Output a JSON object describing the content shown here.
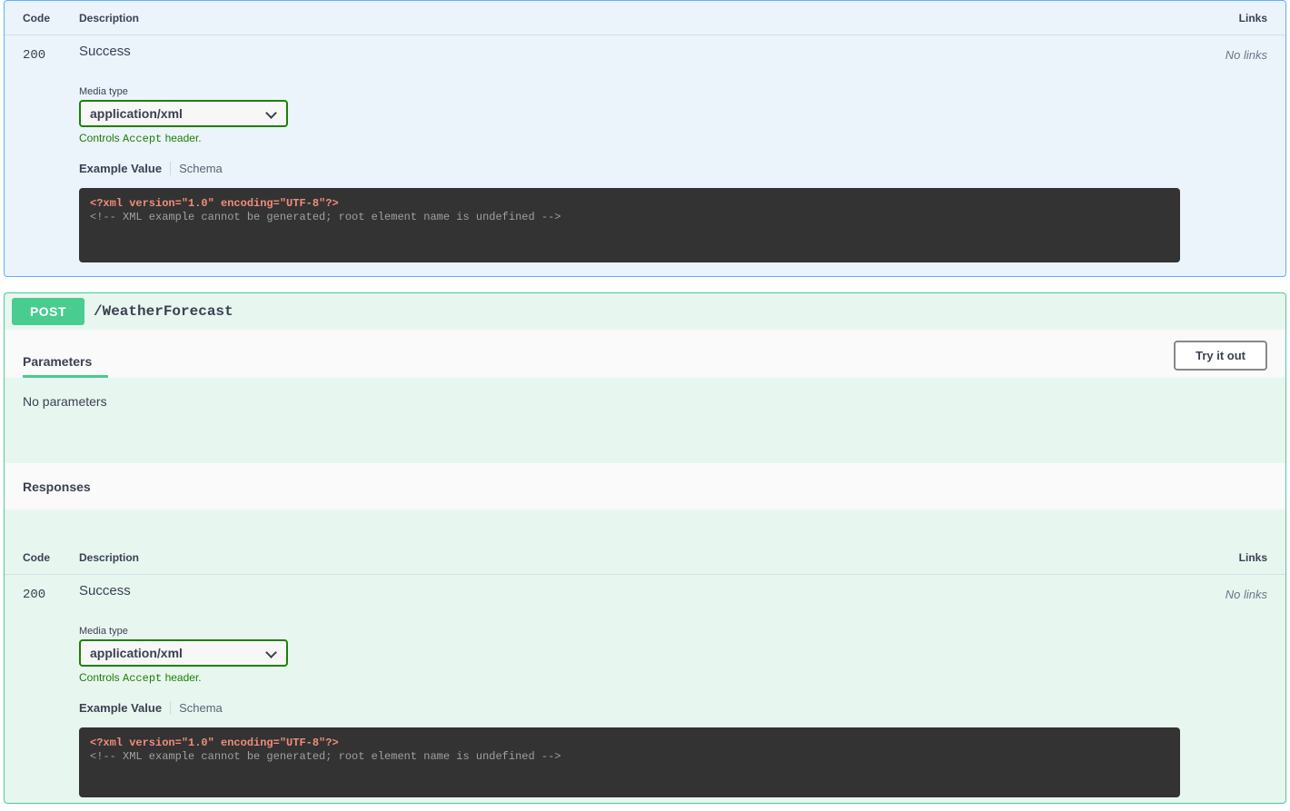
{
  "get_block": {
    "responses_table": {
      "headers": {
        "code": "Code",
        "description": "Description",
        "links": "Links"
      },
      "row": {
        "code": "200",
        "description_title": "Success",
        "links": "No links",
        "media_type_label": "Media type",
        "media_type_value": "application/xml",
        "controls_prefix": "Controls ",
        "controls_code": "Accept",
        "controls_suffix": " header.",
        "example_tab_active": "Example Value",
        "example_tab_inactive": "Schema",
        "code_line_1": "<?xml version=\"1.0\" encoding=\"UTF-8\"?>",
        "code_line_2": "<!-- XML example cannot be generated; root element name is undefined -->"
      }
    }
  },
  "post_block": {
    "method": "POST",
    "path": "/WeatherForecast",
    "method_color": "#49cc90",
    "block_border_color": "#49cc90",
    "block_background": "#e8f6f0",
    "parameters_tab": "Parameters",
    "try_it_out_label": "Try it out",
    "no_parameters": "No parameters",
    "responses_title": "Responses",
    "responses_table": {
      "headers": {
        "code": "Code",
        "description": "Description",
        "links": "Links"
      },
      "row": {
        "code": "200",
        "description_title": "Success",
        "links": "No links",
        "media_type_label": "Media type",
        "media_type_value": "application/xml",
        "controls_prefix": "Controls ",
        "controls_code": "Accept",
        "controls_suffix": " header.",
        "example_tab_active": "Example Value",
        "example_tab_inactive": "Schema",
        "code_line_1": "<?xml version=\"1.0\" encoding=\"UTF-8\"?>",
        "code_line_2": "<!-- XML example cannot be generated; root element name is undefined -->"
      }
    }
  }
}
